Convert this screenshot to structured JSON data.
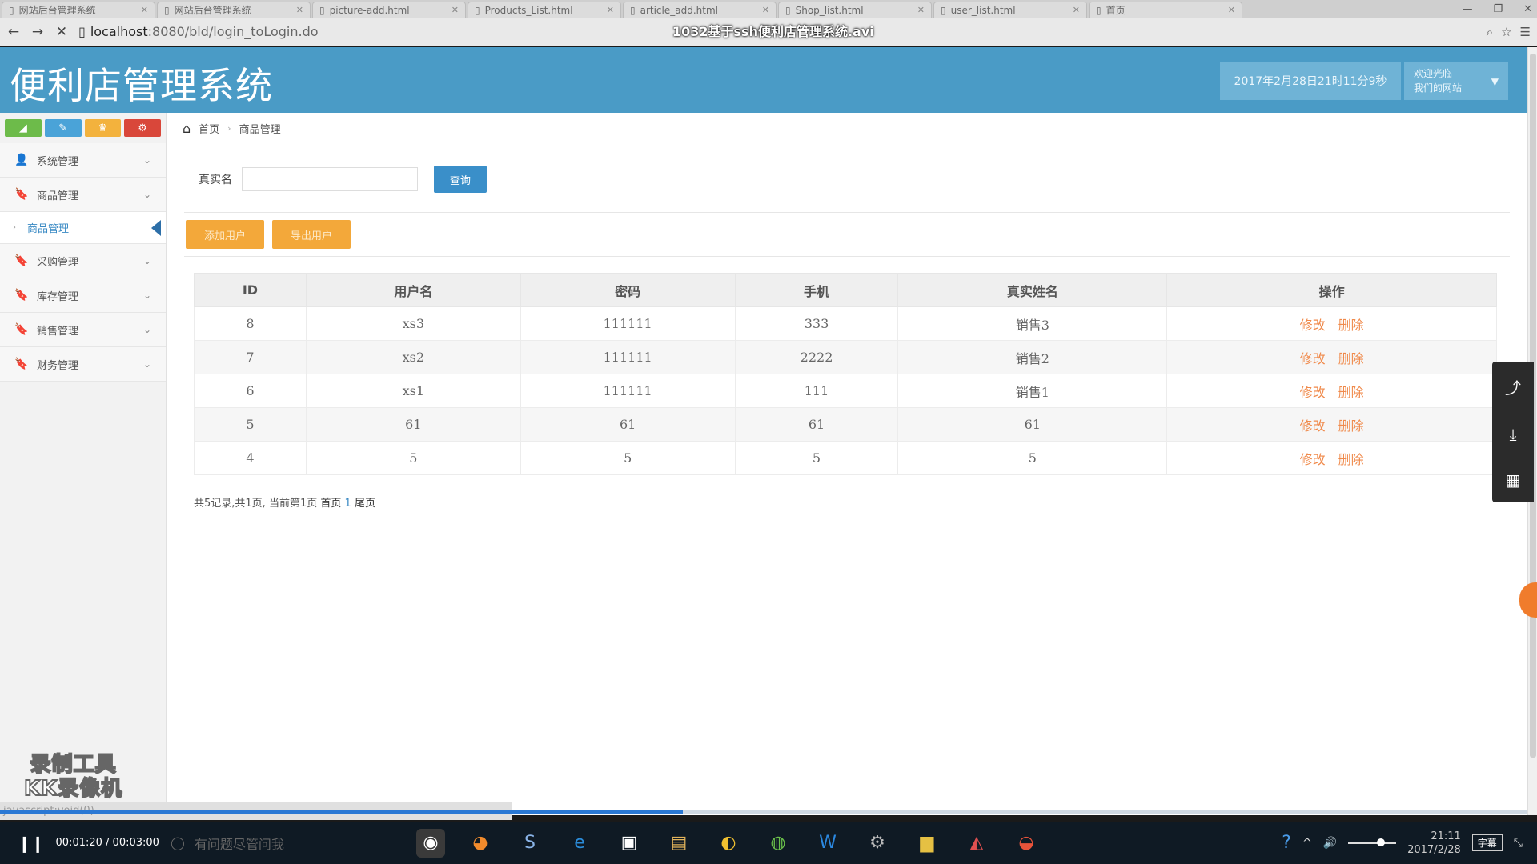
{
  "browser": {
    "tabs": [
      {
        "label": "网站后台管理系统"
      },
      {
        "label": "网站后台管理系统"
      },
      {
        "label": "picture-add.html"
      },
      {
        "label": "Products_List.html"
      },
      {
        "label": "article_add.html"
      },
      {
        "label": "Shop_list.html"
      },
      {
        "label": "user_list.html"
      },
      {
        "label": "首页"
      }
    ],
    "url_host": "localhost",
    "url_path": ":8080/bld/login_toLogin.do",
    "video_title": "1032基于ssh便利店管理系统.avi"
  },
  "header": {
    "logo": "便利店管理系统",
    "datetime": "2017年2月28日21时11分9秒",
    "welcome_line1": "欢迎光临",
    "welcome_line2": "我们的网站"
  },
  "sidebar": {
    "items": [
      {
        "label": "系统管理",
        "icon": "user-icon"
      },
      {
        "label": "商品管理",
        "icon": "bookmark-icon"
      },
      {
        "label": "采购管理",
        "icon": "bookmark-icon"
      },
      {
        "label": "库存管理",
        "icon": "bookmark-icon"
      },
      {
        "label": "销售管理",
        "icon": "bookmark-icon"
      },
      {
        "label": "财务管理",
        "icon": "bookmark-icon"
      }
    ],
    "sub_item": "商品管理",
    "watermark_line1": "录制工具",
    "watermark_line2": "KK录像机"
  },
  "breadcrumb": {
    "home": "首页",
    "current": "商品管理"
  },
  "search": {
    "label": "真实名",
    "value": "",
    "button": "查询"
  },
  "toolbar": {
    "add_label": "添加用户",
    "export_label": "导出用户"
  },
  "table": {
    "headers": [
      "ID",
      "用户名",
      "密码",
      "手机",
      "真实姓名",
      "操作"
    ],
    "rows": [
      {
        "id": "8",
        "username": "xs3",
        "password": "111111",
        "phone": "333",
        "realname": "销售3"
      },
      {
        "id": "7",
        "username": "xs2",
        "password": "111111",
        "phone": "2222",
        "realname": "销售2"
      },
      {
        "id": "6",
        "username": "xs1",
        "password": "111111",
        "phone": "111",
        "realname": "销售1"
      },
      {
        "id": "5",
        "username": "61",
        "password": "61",
        "phone": "61",
        "realname": "61"
      },
      {
        "id": "4",
        "username": "5",
        "password": "5",
        "phone": "5",
        "realname": "5"
      }
    ],
    "edit_label": "修改",
    "delete_label": "删除"
  },
  "pager": {
    "summary": "共5记录,共1页, 当前第1页",
    "first": "首页",
    "current": "1",
    "last": "尾页"
  },
  "status_url": "javascript:void(0)",
  "video": {
    "time": "00:01:20 / 00:03:00",
    "progress": 0.447
  },
  "taskbar": {
    "search_placeholder": "有问题尽管问我",
    "clock_time": "21:11",
    "clock_date": "2017/2/28",
    "subtitle_btn": "字幕"
  },
  "colors": {
    "header": "#4a9bc6",
    "accent_orange": "#f3a83a",
    "link_orange": "#f08a4b",
    "query_blue": "#3a8fc9"
  }
}
